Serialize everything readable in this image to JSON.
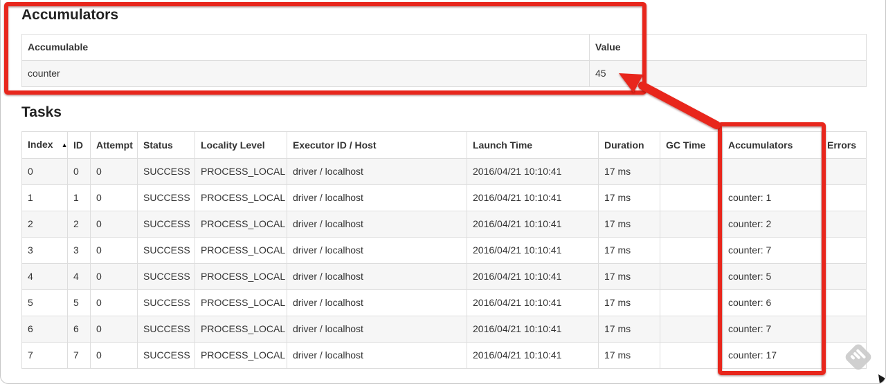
{
  "accumulators": {
    "title": "Accumulators",
    "headers": [
      "Accumulable",
      "Value"
    ],
    "rows": [
      [
        "counter",
        "45"
      ]
    ]
  },
  "tasks": {
    "title": "Tasks",
    "sort_icon": "▲",
    "headers": [
      "Index",
      "ID",
      "Attempt",
      "Status",
      "Locality Level",
      "Executor ID / Host",
      "Launch Time",
      "Duration",
      "GC Time",
      "Accumulators",
      "Errors"
    ],
    "rows": [
      [
        "0",
        "0",
        "0",
        "SUCCESS",
        "PROCESS_LOCAL",
        "driver / localhost",
        "2016/04/21 10:10:41",
        "17 ms",
        "",
        "",
        ""
      ],
      [
        "1",
        "1",
        "0",
        "SUCCESS",
        "PROCESS_LOCAL",
        "driver / localhost",
        "2016/04/21 10:10:41",
        "17 ms",
        "",
        "counter: 1",
        ""
      ],
      [
        "2",
        "2",
        "0",
        "SUCCESS",
        "PROCESS_LOCAL",
        "driver / localhost",
        "2016/04/21 10:10:41",
        "17 ms",
        "",
        "counter: 2",
        ""
      ],
      [
        "3",
        "3",
        "0",
        "SUCCESS",
        "PROCESS_LOCAL",
        "driver / localhost",
        "2016/04/21 10:10:41",
        "17 ms",
        "",
        "counter: 7",
        ""
      ],
      [
        "4",
        "4",
        "0",
        "SUCCESS",
        "PROCESS_LOCAL",
        "driver / localhost",
        "2016/04/21 10:10:41",
        "17 ms",
        "",
        "counter: 5",
        ""
      ],
      [
        "5",
        "5",
        "0",
        "SUCCESS",
        "PROCESS_LOCAL",
        "driver / localhost",
        "2016/04/21 10:10:41",
        "17 ms",
        "",
        "counter: 6",
        ""
      ],
      [
        "6",
        "6",
        "0",
        "SUCCESS",
        "PROCESS_LOCAL",
        "driver / localhost",
        "2016/04/21 10:10:41",
        "17 ms",
        "",
        "counter: 7",
        ""
      ],
      [
        "7",
        "7",
        "0",
        "SUCCESS",
        "PROCESS_LOCAL",
        "driver / localhost",
        "2016/04/21 10:10:41",
        "17 ms",
        "",
        "counter: 17",
        ""
      ]
    ]
  },
  "annotations": {
    "accent_color": "#e8261b",
    "watermark_color": "#cbcbcb",
    "cursor_color": "#1a1a1a"
  }
}
